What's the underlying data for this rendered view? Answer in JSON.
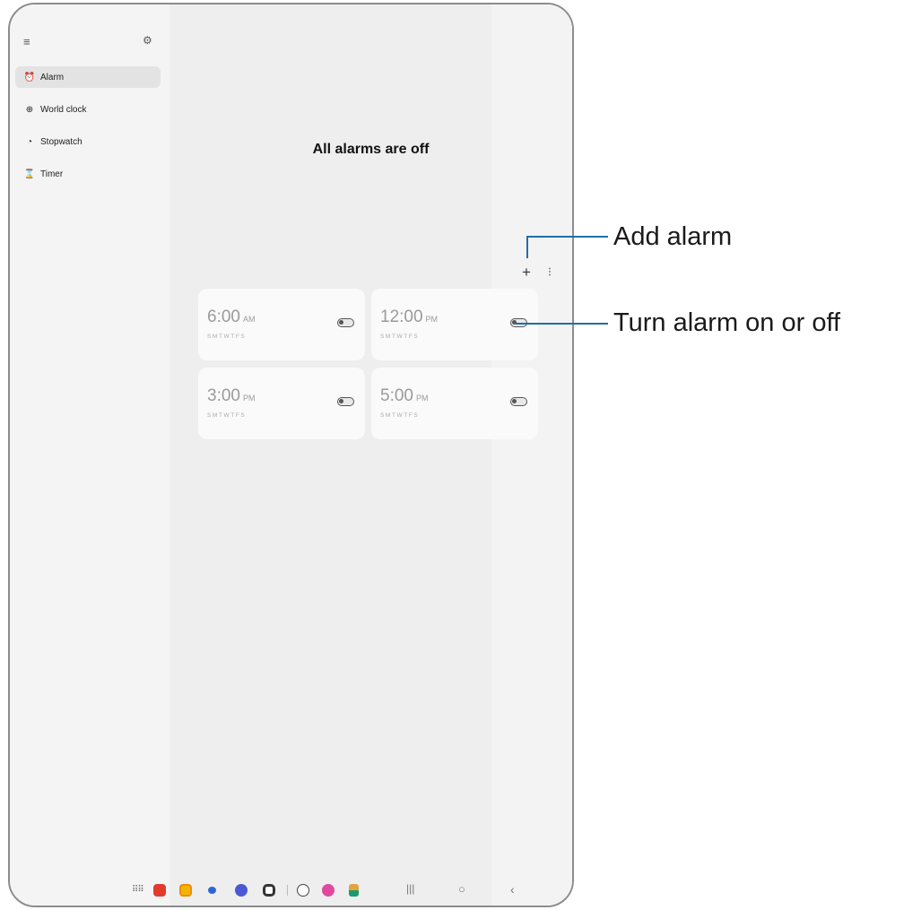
{
  "sidebar": {
    "menu_icon": "menu-icon",
    "settings_icon": "gear-icon",
    "items": [
      {
        "label": "Alarm",
        "icon": "alarm-icon",
        "active": true
      },
      {
        "label": "World clock",
        "icon": "globe-icon",
        "active": false
      },
      {
        "label": "Stopwatch",
        "icon": "stopwatch-icon",
        "active": false
      },
      {
        "label": "Timer",
        "icon": "hourglass-icon",
        "active": false
      }
    ]
  },
  "main": {
    "empty_title": "All alarms are off",
    "add_icon": "plus-icon",
    "more_icon": "more-vertical-icon",
    "alarms": [
      {
        "time": "6:00",
        "period": "AM",
        "days": "SMTWTFS",
        "enabled": false
      },
      {
        "time": "12:00",
        "period": "PM",
        "days": "SMTWTFS",
        "enabled": false
      },
      {
        "time": "3:00",
        "period": "PM",
        "days": "SMTWTFS",
        "enabled": false
      },
      {
        "time": "5:00",
        "period": "PM",
        "days": "SMTWTFS",
        "enabled": false
      }
    ]
  },
  "taskbar": {
    "apps": [
      "apps-grid-icon",
      "app-red-icon",
      "app-yellow-icon",
      "messages-icon",
      "internet-icon",
      "camera-icon",
      "clock-icon",
      "gallery-icon",
      "multi-icon"
    ],
    "nav": [
      "recents-icon",
      "home-icon",
      "back-icon"
    ]
  },
  "callouts": {
    "add_alarm": "Add alarm",
    "toggle_alarm": "Turn alarm on or off",
    "line_color": "#1e6fa8"
  }
}
